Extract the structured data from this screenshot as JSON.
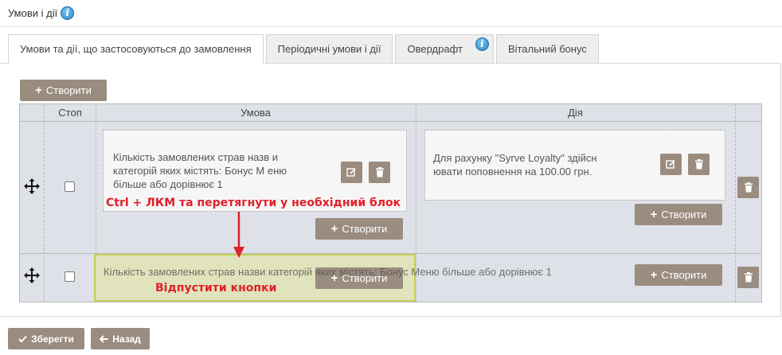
{
  "page": {
    "title": "Умови і дії"
  },
  "tabs": [
    {
      "label": "Умови та дії, що застосовуються до замовлення",
      "active": true
    },
    {
      "label": "Періодичні умови і дії",
      "active": false
    },
    {
      "label": "Овердрафт",
      "active": false,
      "has_info": true
    },
    {
      "label": "Вітальний бонус",
      "active": false
    }
  ],
  "toolbar": {
    "create_label": "Створити"
  },
  "table": {
    "columns": [
      "Стоп",
      "Умова",
      "Дія"
    ],
    "rows": [
      {
        "stop_checked": false,
        "condition_text": "Кількість замовлених страв назв и категорій яких містять: Бонус М еню більше або дорівнює 1",
        "action_text": "Для рахунку \"Syrve Loyalty\" здійсн ювати поповнення на 100.00 грн.",
        "create_label": "Створити",
        "action_create_label": "Створити"
      },
      {
        "stop_checked": false,
        "condition_text": "Кількість замовлених страв назви категорій яких містять: Бонус Меню більше або дорівнює 1",
        "create_label": "Створити",
        "action_create_label": "Створити"
      }
    ]
  },
  "annotations": {
    "drag_hint": "Ctrl + ЛКМ та перетягнути у необхідний блок",
    "release_hint": "Відпустити кнопки",
    "color": "#e0202a"
  },
  "footer": {
    "save_label": "Зберегти",
    "back_label": "Назад"
  },
  "colors": {
    "button": "#9b8c80",
    "grid_bg": "#dfe1e8",
    "drop_zone": "#e0e696"
  }
}
